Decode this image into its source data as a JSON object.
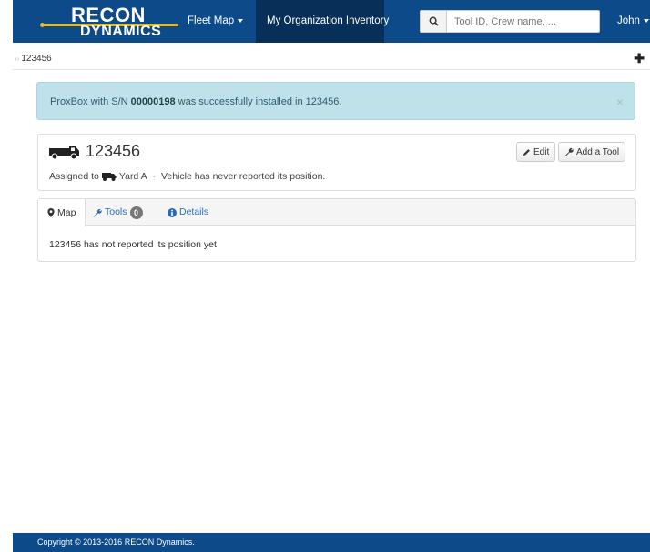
{
  "navbar": {
    "logo_top": "RECON",
    "logo_bottom": "DYNAMICS",
    "fleet_map": "Fleet Map",
    "inventory": "My Organization Inventory",
    "search_placeholder": "Tool ID, Crew name, ...",
    "user": "John"
  },
  "breadcrumb": {
    "current": "123456"
  },
  "alert": {
    "prefix": "ProxBox with S/N ",
    "serial": "00000198",
    "suffix": " was successfully installed in 123456.",
    "close": "×"
  },
  "vehicle": {
    "name": "123456",
    "assigned_prefix": "Assigned to",
    "yard": "Yard A",
    "separator": "·",
    "status": "Vehicle has never reported its position.",
    "edit_label": "Edit",
    "add_tool_label": "Add a Tool"
  },
  "tabs": {
    "map": "Map",
    "tools": "Tools",
    "tools_count": "0",
    "details": "Details",
    "message": "123456 has not reported its position yet"
  },
  "footer": {
    "copyright": "Copyright © 2013-2016 RECON Dynamics."
  },
  "colors": {
    "brand": "#0d4a8a",
    "brand_dark": "#082f57",
    "accent": "#e8b820",
    "alert_bg": "#bfe2ea",
    "link": "#2a6ebb"
  }
}
